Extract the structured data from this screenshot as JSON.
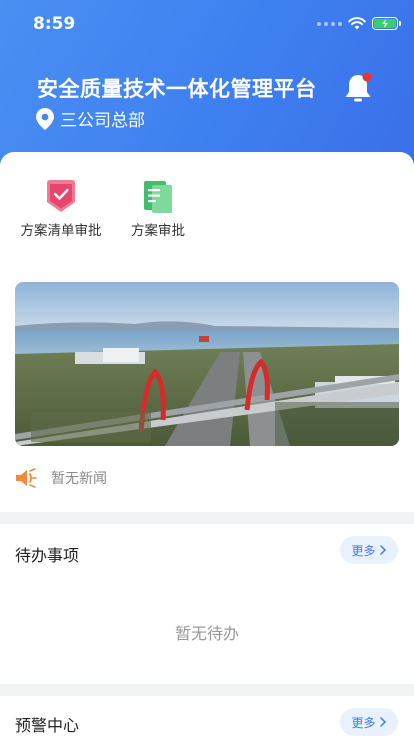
{
  "status_bar": {
    "time": "8:59",
    "battery_color": "#35d06b"
  },
  "header": {
    "title": "安全质量技术一体化管理平台",
    "location": "三公司总部",
    "icons": [
      "location-pin-icon",
      "bell-icon"
    ],
    "notification_dot_color": "#e5372d",
    "gradient_colors": [
      "#4a8ff2",
      "#3a6ee8"
    ]
  },
  "quick_actions": [
    {
      "label": "方案清单审批",
      "icon": "checklist-approval-icon",
      "color": "#e6466b"
    },
    {
      "label": "方案审批",
      "icon": "document-approval-icon",
      "color": "#3fbf6b"
    }
  ],
  "banner": {
    "icon": "bridge-photo"
  },
  "news": {
    "text": "暂无新闻",
    "icon": "speaker-icon"
  },
  "todo": {
    "title": "待办事项",
    "more_label": "更多",
    "empty_text": "暂无待办"
  },
  "warning": {
    "title": "预警中心",
    "more_label": "更多"
  },
  "accent_color": "#3b7cf0"
}
